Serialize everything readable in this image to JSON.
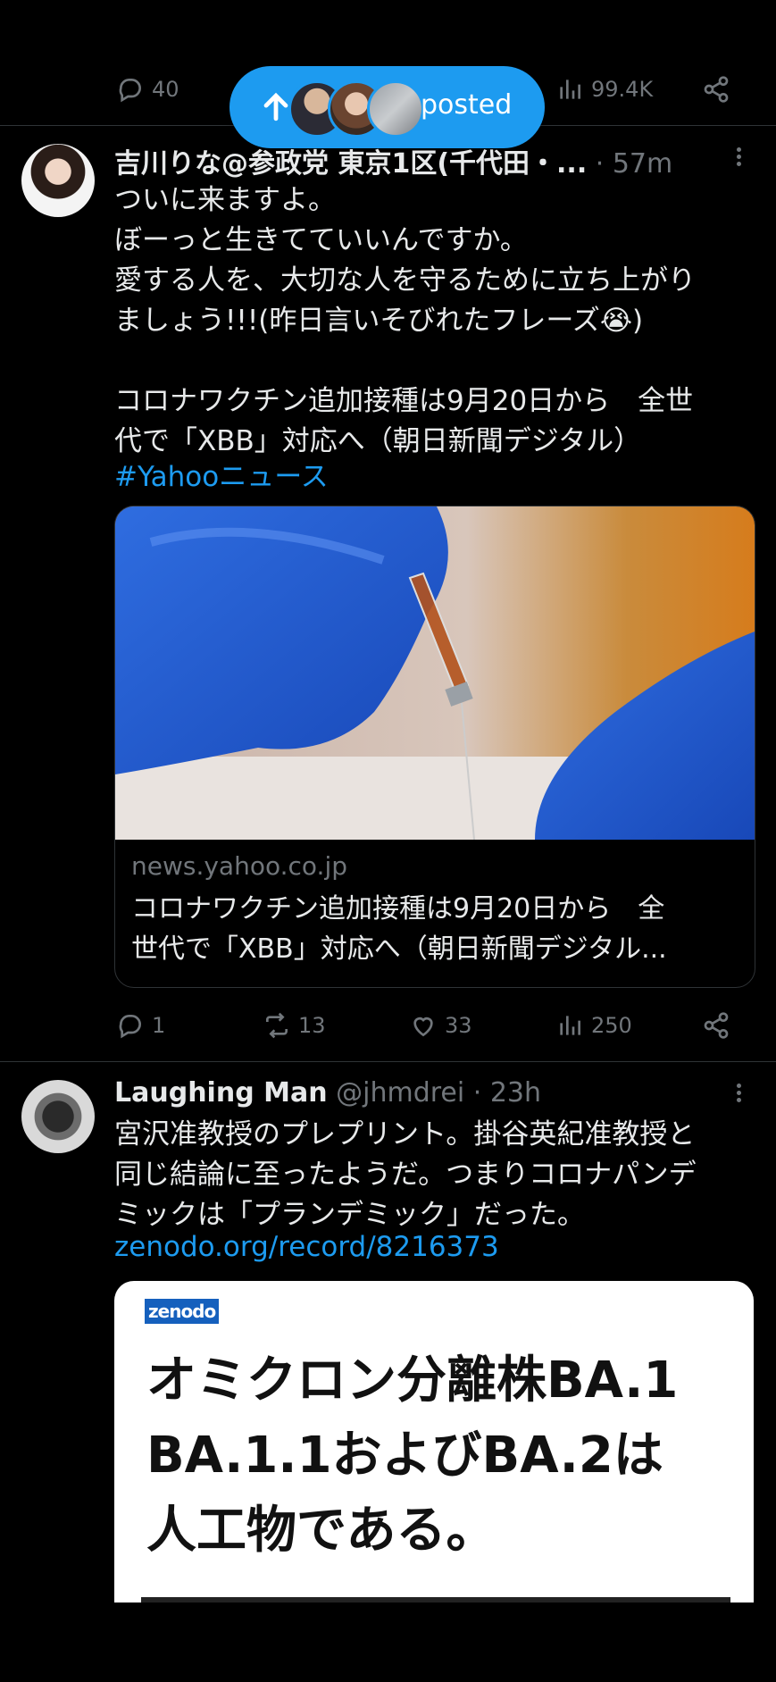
{
  "prev_tweet": {
    "replies": "40",
    "views": "99.4K"
  },
  "posted_pill": {
    "label": "posted"
  },
  "tweet1": {
    "display_name": "吉川りな@参政党 東京1区(千代田・...",
    "time": "· 57m",
    "text": "ついに来ますよ。\nぼーっと生きてていいんですか。\n愛する人を、大切な人を守るために立ち上がり\nましょう!!!(昨日言いそびれたフレーズ😭)\n\nコロナワクチン追加接種は9月20日から　全世\n代で「XBB」対応へ（朝日新聞デジタル）",
    "hashtag": "#Yahooニュース",
    "card_domain": "news.yahoo.co.jp",
    "card_title": "コロナワクチン追加接種は9月20日から　全\n世代で「XBB」対応へ（朝日新聞デジタル...",
    "replies": "1",
    "reposts": "13",
    "likes": "33",
    "views": "250"
  },
  "tweet2": {
    "display_name": "Laughing Man",
    "handle": "@jhmdrei",
    "time": "· 23h",
    "text": "宮沢准教授のプレプリント。掛谷英紀准教授と\n同じ結論に至ったようだ。つまりコロナパンデ\nミックは「プランデミック」だった。",
    "link": "zenodo.org/record/8216373",
    "doc_logo": "zenodo",
    "doc_headline": "オミクロン分離株BA.1\nBA.1.1およびBA.2は\n人工物である。"
  },
  "colors": {
    "accent": "#1d9bf0",
    "muted": "#71767b",
    "divider": "#2f3336"
  }
}
